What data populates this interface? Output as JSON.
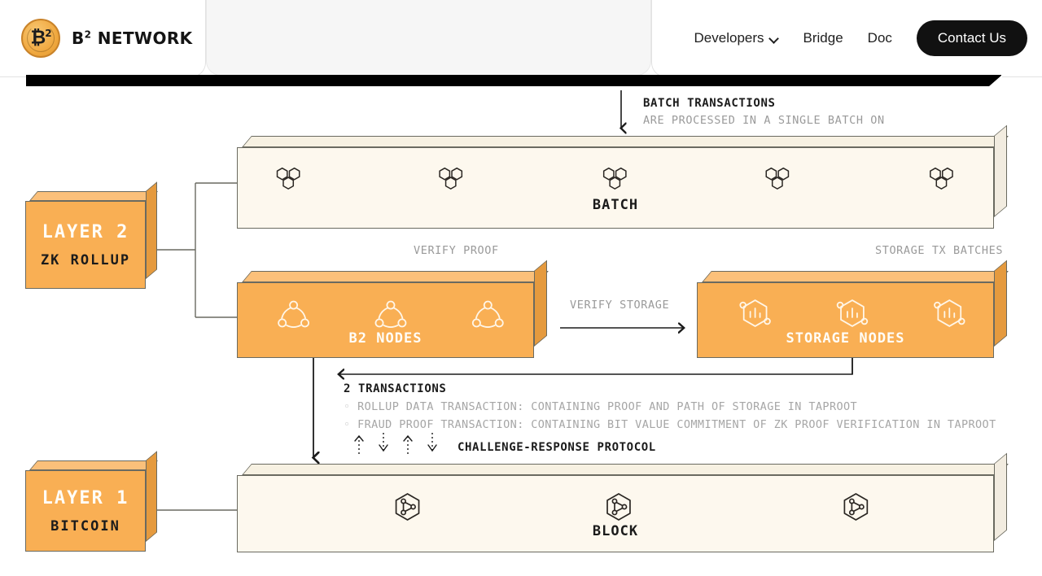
{
  "header": {
    "brand": "B² NETWORK",
    "brand_main": "B",
    "brand_sup": "2",
    "brand_rest": " NETWORK",
    "logo_icon": "bitcoin-b2-coin-icon",
    "nav": [
      {
        "label": "Developers",
        "has_dropdown": true,
        "icon": "chevron-down-icon"
      },
      {
        "label": "Bridge",
        "has_dropdown": false
      },
      {
        "label": "Doc",
        "has_dropdown": false
      }
    ],
    "cta": {
      "label": "Contact Us",
      "bg": "#111111",
      "color": "#ffffff"
    }
  },
  "diagram": {
    "colors": {
      "orange": "#F9AF54",
      "orange_top": "#FBC07A",
      "orange_side": "#E59A3E",
      "cream": "#FDF8EE",
      "cream_top": "#F7F1E2",
      "cream_side": "#F2ECE0",
      "stroke": "#6A6A60",
      "annotation_grey": "#9A9A9A",
      "annotation_dark": "#1B1B1B"
    },
    "layers": [
      {
        "id": "layer2",
        "title": "LAYER 2",
        "subtitle": "ZK ROLLUP"
      },
      {
        "id": "layer1",
        "title": "LAYER 1",
        "subtitle": "BITCOIN"
      }
    ],
    "boxes": [
      {
        "id": "batch",
        "label": "BATCH",
        "icon": "hex-cluster-icon",
        "icon_count": 5,
        "fill": "cream"
      },
      {
        "id": "b2-nodes",
        "label": "B2 NODES",
        "icon": "node-network-icon",
        "icon_count": 3,
        "fill": "orange"
      },
      {
        "id": "storage-nodes",
        "label": "STORAGE NODES",
        "icon": "hex-storage-bars-icon",
        "icon_count": 3,
        "fill": "orange"
      },
      {
        "id": "block",
        "label": "BLOCK",
        "icon": "hex-triangle-node-icon",
        "icon_count": 3,
        "fill": "cream"
      }
    ],
    "annotations": {
      "batch_transactions_title": "BATCH TRANSACTIONS",
      "batch_transactions_sub": "ARE PROCESSED IN A SINGLE BATCH ON",
      "verify_proof": "VERIFY PROOF",
      "storage_tx_batches": "STORAGE TX BATCHES",
      "verify_storage": "VERIFY STORAGE",
      "two_transactions_title": "2 TRANSACTIONS",
      "transaction_bullets": [
        "ROLLUP DATA TRANSACTION: CONTAINING PROOF AND PATH OF STORAGE IN TAPROOT",
        "FRAUD PROOF TRANSACTION: CONTAINING BIT VALUE COMMITMENT OF ZK PROOF VERIFICATION IN TAPROOT"
      ],
      "challenge_response": "CHALLENGE-RESPONSE PROTOCOL",
      "challenge_arrows": [
        "up",
        "down",
        "up",
        "down"
      ]
    }
  }
}
